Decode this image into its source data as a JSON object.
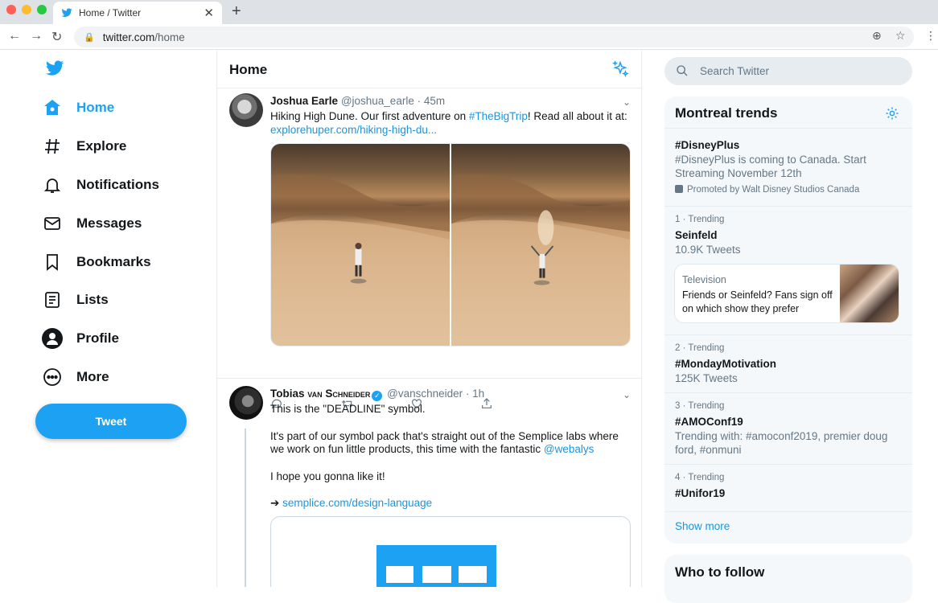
{
  "browser": {
    "tab_title": "Home / Twitter",
    "url_host": "twitter.com",
    "url_path": "/home"
  },
  "nav": {
    "items": [
      {
        "label": "Home",
        "icon": "home-icon"
      },
      {
        "label": "Explore",
        "icon": "hashtag-icon"
      },
      {
        "label": "Notifications",
        "icon": "bell-icon"
      },
      {
        "label": "Messages",
        "icon": "envelope-icon"
      },
      {
        "label": "Bookmarks",
        "icon": "bookmark-icon"
      },
      {
        "label": "Lists",
        "icon": "list-icon"
      },
      {
        "label": "Profile",
        "icon": "profile-icon"
      },
      {
        "label": "More",
        "icon": "more-icon"
      }
    ],
    "tweet_button": "Tweet"
  },
  "timeline": {
    "title": "Home",
    "tweets": [
      {
        "name": "Joshua Earle",
        "handle": "@joshua_earle",
        "time": "· 45m",
        "text_before": "Hiking High Dune. Our first adventure on ",
        "hashtag": "#TheBigTrip",
        "text_after": "! Read all about it at:",
        "link": "explorehuper.com/hiking-high-du..."
      },
      {
        "name_first": "Tobias",
        "name_last": "van Schneider",
        "handle": "@vanschneider",
        "time": "· 1h",
        "line1": "This is the \"DEADLINE\" symbol.",
        "line2_before": "It's part of our symbol pack that's straight out of the Semplice labs where we work on fun little products, this time with the fantastic ",
        "mention": "@webalys",
        "line3": "I hope you gonna like it!",
        "arrow": "➔",
        "link": "semplice.com/design-language"
      }
    ]
  },
  "search": {
    "placeholder": "Search Twitter"
  },
  "trends": {
    "title": "Montreal trends",
    "promoted": {
      "name": "#DisneyPlus",
      "description": "#DisneyPlus is coming to Canada. Start Streaming November 12th",
      "promoted_by": "Promoted by Walt Disney Studios Canada"
    },
    "items": [
      {
        "meta": "1 · Trending",
        "name": "Seinfeld",
        "sub": "10.9K Tweets"
      },
      {
        "meta": "2 · Trending",
        "name": "#MondayMotivation",
        "sub": "125K Tweets"
      },
      {
        "meta": "3 · Trending",
        "name": "#AMOConf19",
        "sub": "Trending with: #amoconf2019, premier doug ford, #onmuni"
      },
      {
        "meta": "4 · Trending",
        "name": "#Unifor19",
        "sub": ""
      }
    ],
    "card": {
      "category": "Television",
      "headline": "Friends or Seinfeld? Fans sign off on which show they prefer"
    },
    "show_more": "Show more"
  },
  "who_to_follow": {
    "title": "Who to follow"
  },
  "colors": {
    "accent": "#1da1f2",
    "link": "#1b95e0",
    "muted": "#657786"
  }
}
